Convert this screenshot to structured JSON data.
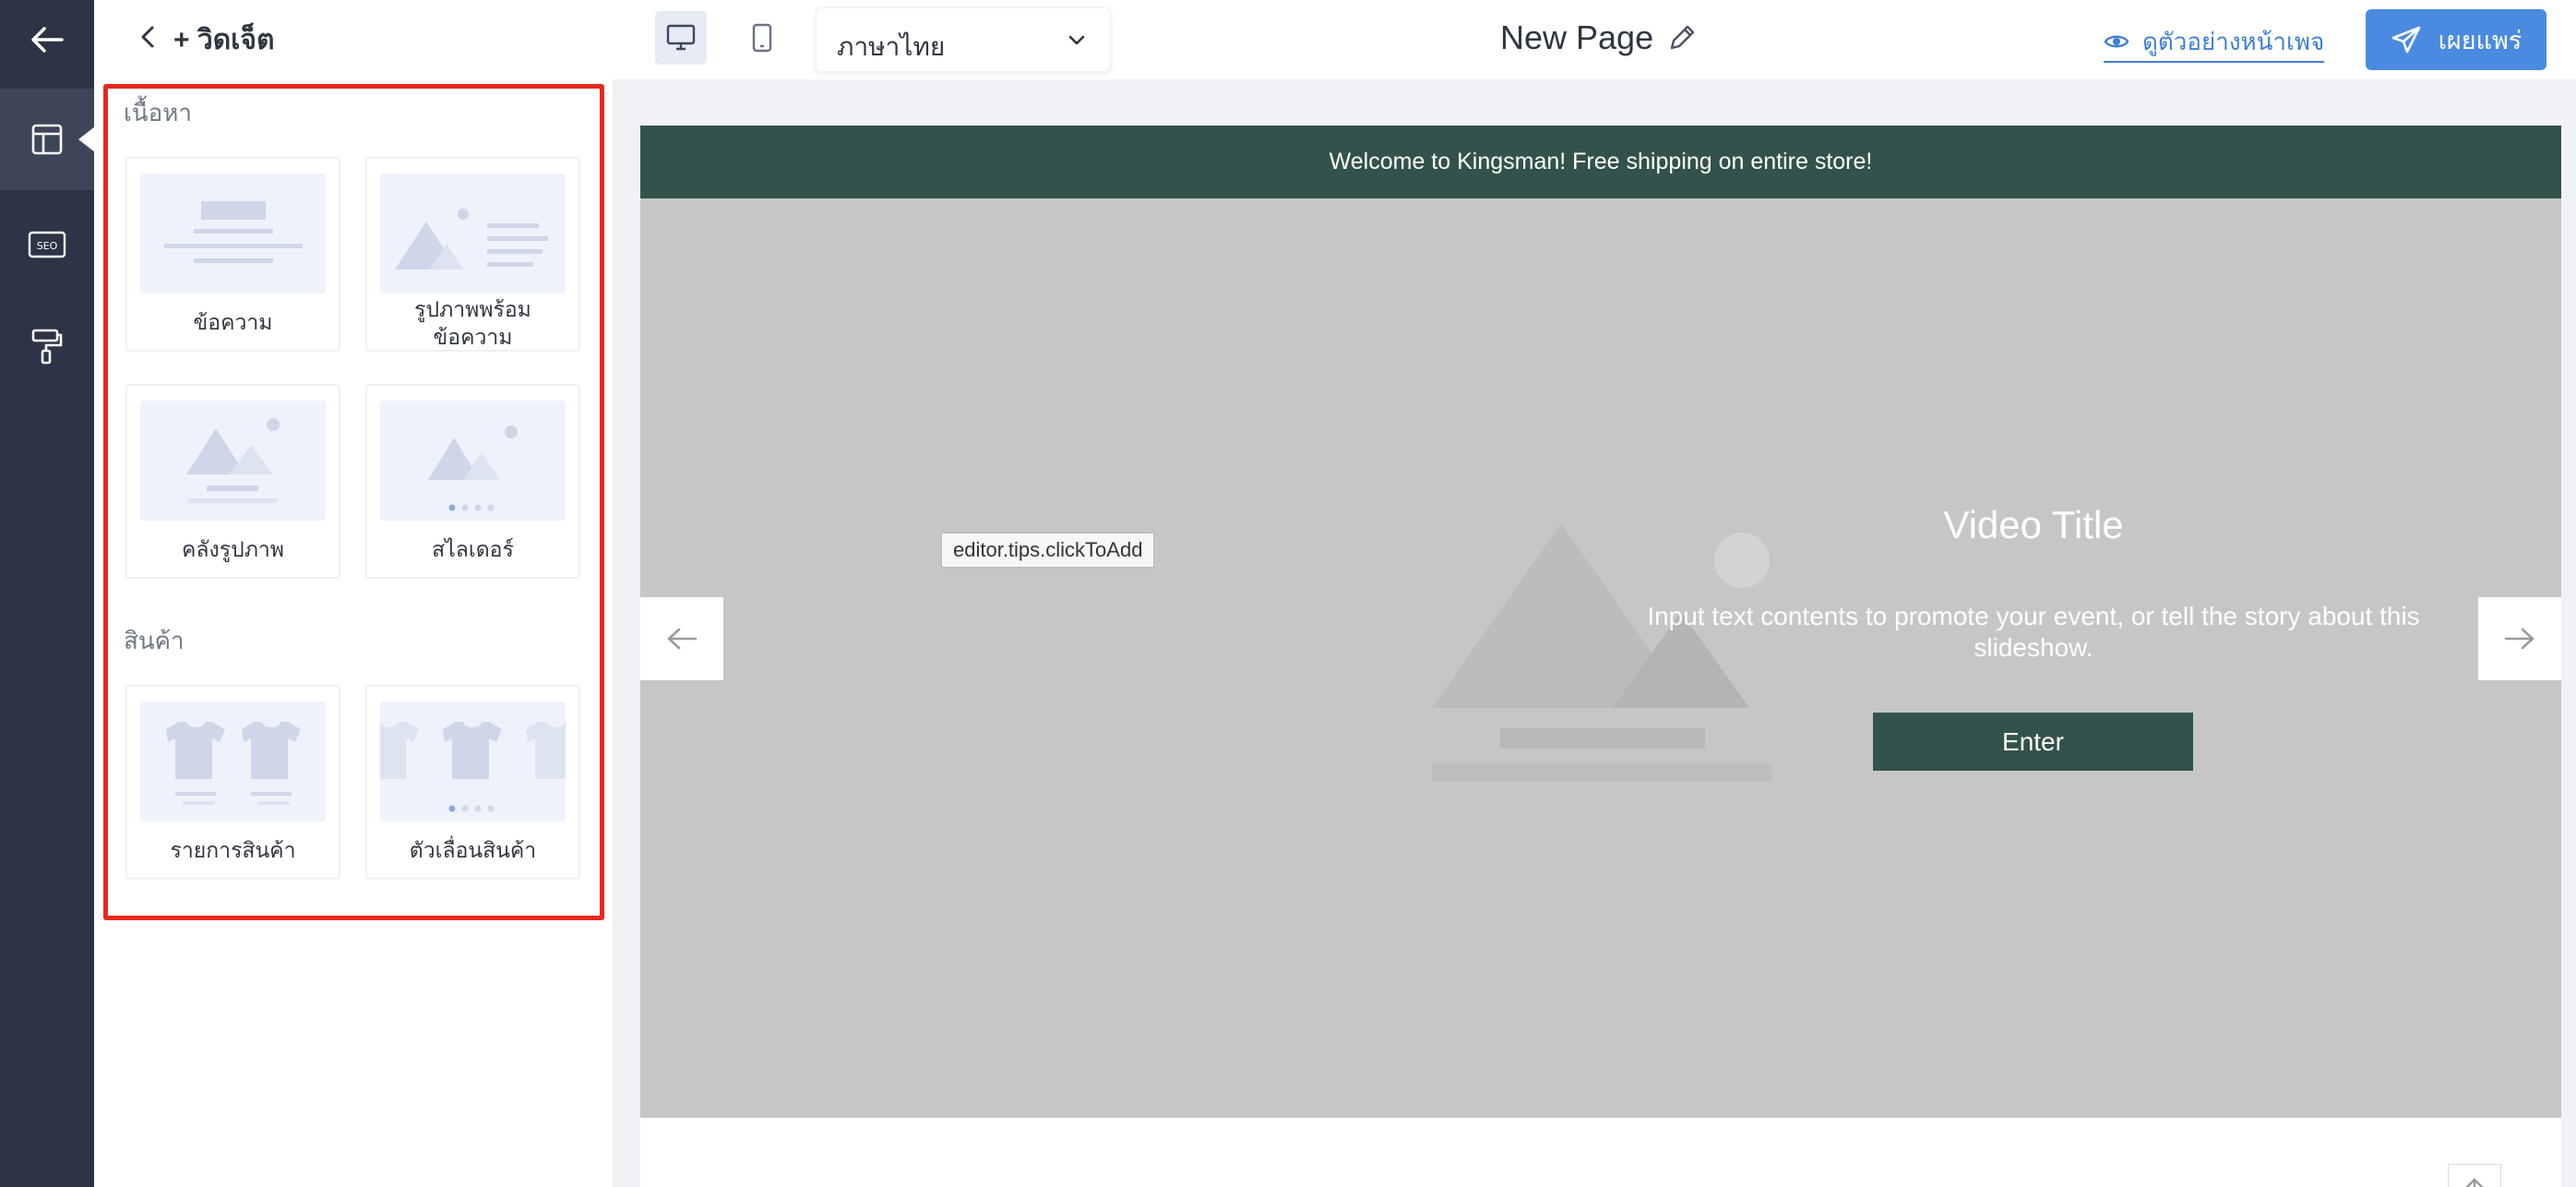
{
  "rail": {
    "items": [
      {
        "icon": "back-arrow-icon"
      },
      {
        "icon": "layout-icon",
        "active": true
      },
      {
        "icon": "seo-icon",
        "label": "SEO"
      },
      {
        "icon": "paint-roller-icon"
      }
    ]
  },
  "panel": {
    "title": "+ วิดเจ็ต",
    "sections": [
      {
        "title": "เนื้อหา",
        "items": [
          {
            "label": "ข้อความ",
            "icon": "text-widget-icon"
          },
          {
            "label_line1": "รูปภาพพร้อม",
            "label_line2": "ข้อความ",
            "icon": "image-with-text-widget-icon"
          },
          {
            "label": "คลังรูปภาพ",
            "icon": "gallery-widget-icon"
          },
          {
            "label": "สไลเดอร์",
            "icon": "slider-widget-icon"
          }
        ]
      },
      {
        "title": "สินค้า",
        "items": [
          {
            "label": "รายการสินค้า",
            "icon": "product-list-widget-icon"
          },
          {
            "label": "ตัวเลื่อนสินค้า",
            "icon": "product-slider-widget-icon"
          }
        ]
      }
    ]
  },
  "topbar": {
    "language": "ภาษาไทย",
    "page_title": "New Page",
    "preview_label": "ดูตัวอย่างหน้าเพจ",
    "publish_label": "เผยแพร่"
  },
  "canvas": {
    "announcement": "Welcome to Kingsman! Free shipping on entire store!",
    "tooltip": "editor.tips.clickToAdd",
    "slide": {
      "title": "Video Title",
      "description": "Input text contents to promote your event, or tell the story about this slideshow.",
      "button_label": "Enter"
    }
  },
  "colors": {
    "rail": "#2c3445",
    "accent": "#4a8ae0",
    "announce_bg": "#33524c",
    "highlight": "#e8281e"
  }
}
